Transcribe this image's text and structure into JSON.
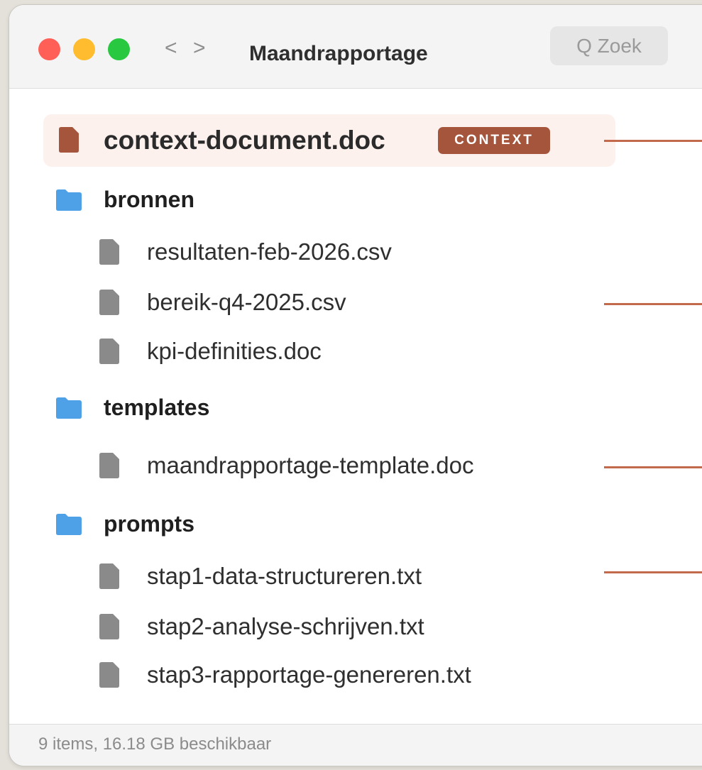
{
  "window": {
    "title": "Maandrapportage",
    "nav_back": "<",
    "nav_forward": ">",
    "search_placeholder": "Q Zoek"
  },
  "context_file": {
    "name": "context-document.doc",
    "badge": "CONTEXT",
    "icon": "document-icon",
    "icon_color": "#a6553d"
  },
  "folders": [
    {
      "name": "bronnen",
      "files": [
        "resultaten-feb-2026.csv",
        "bereik-q4-2025.csv",
        "kpi-definities.doc"
      ]
    },
    {
      "name": "templates",
      "files": [
        "maandrapportage-template.doc"
      ]
    },
    {
      "name": "prompts",
      "files": [
        "stap1-data-structureren.txt",
        "stap2-analyse-schrijven.txt",
        "stap3-rapportage-genereren.txt"
      ]
    }
  ],
  "status": "9 items, 16.18 GB beschikbaar",
  "colors": {
    "accent": "#c26a4b",
    "folder": "#4ea1e6",
    "file": "#8a8a8a",
    "badge": "#a6553d"
  }
}
